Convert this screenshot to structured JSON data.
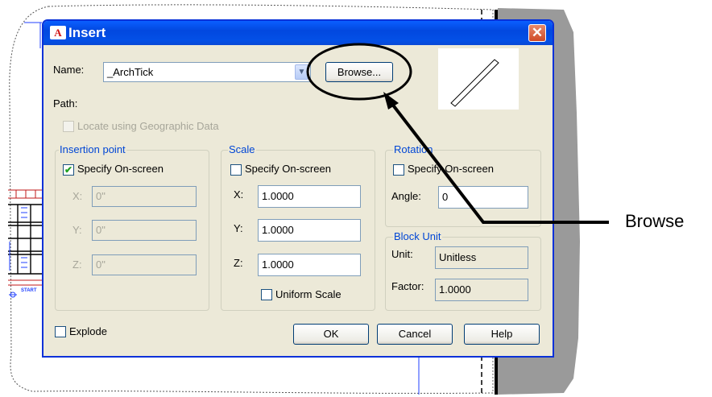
{
  "dialog": {
    "title": "Insert",
    "logo_text": "A",
    "close_glyph": "✕"
  },
  "name": {
    "label": "Name:",
    "value": "_ArchTick",
    "dropdown_glyph": "▼"
  },
  "browse": {
    "label": "Browse..."
  },
  "path": {
    "label": "Path:"
  },
  "geo": {
    "label": "Locate using Geographic Data",
    "checked": false,
    "enabled": false
  },
  "insertion": {
    "title": "Insertion point",
    "specify_label": "Specify On-screen",
    "specify_checked": true,
    "specify_mark": "✔",
    "x_label": "X:",
    "x_value": "0\"",
    "y_label": "Y:",
    "y_value": "0\"",
    "z_label": "Z:",
    "z_value": "0\""
  },
  "scale": {
    "title": "Scale",
    "specify_label": "Specify On-screen",
    "specify_checked": false,
    "x_label": "X:",
    "x_value": "1.0000",
    "y_label": "Y:",
    "y_value": "1.0000",
    "z_label": "Z:",
    "z_value": "1.0000",
    "uniform_label": "Uniform Scale",
    "uniform_checked": false
  },
  "rotation": {
    "title": "Rotation",
    "specify_label": "Specify On-screen",
    "specify_checked": false,
    "angle_label": "Angle:",
    "angle_value": "0"
  },
  "block_unit": {
    "title": "Block Unit",
    "unit_label": "Unit:",
    "unit_value": "Unitless",
    "factor_label": "Factor:",
    "factor_value": "1.0000"
  },
  "explode": {
    "label": "Explode",
    "checked": false
  },
  "buttons": {
    "ok": "OK",
    "cancel": "Cancel",
    "help": "Help"
  },
  "background_text": {
    "start_label": "START"
  },
  "annotation": {
    "label": "Browse"
  },
  "colors": {
    "title_bar": "#0054e3",
    "dialog_face": "#ece9d8",
    "group_title": "#0046d5",
    "close_button": "#d04a26"
  }
}
